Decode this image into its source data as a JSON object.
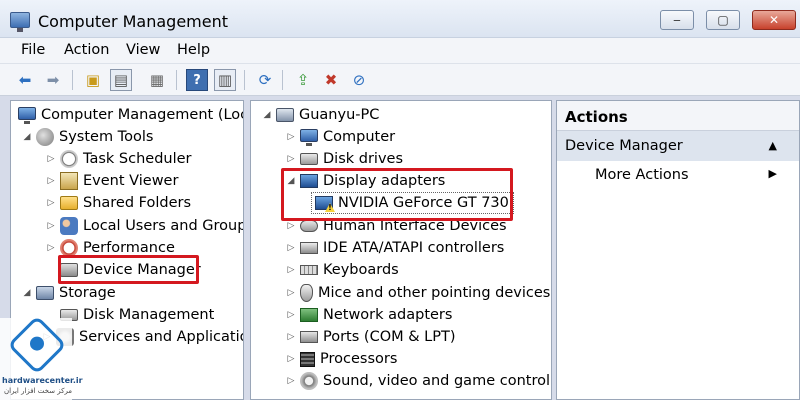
{
  "window": {
    "title": "Computer Management",
    "minimize_glyph": "‒",
    "maximize_glyph": "▢",
    "close_glyph": "✕"
  },
  "menu": {
    "items": [
      "File",
      "Action",
      "View",
      "Help"
    ]
  },
  "toolbar": {
    "icons": [
      "back-arrow-icon",
      "forward-arrow-icon",
      "up-folder-icon",
      "show-hide-tree-icon",
      "properties-icon",
      "help-icon",
      "show-hide-action-pane-icon",
      "scan-hardware-icon",
      "update-driver-icon",
      "uninstall-icon",
      "disable-device-icon"
    ]
  },
  "left_tree": {
    "root": "Computer Management (Local",
    "system_tools": "System Tools",
    "task_scheduler": "Task Scheduler",
    "event_viewer": "Event Viewer",
    "shared_folders": "Shared Folders",
    "local_users": "Local Users and Groups",
    "performance": "Performance",
    "device_manager": "Device Manager",
    "storage": "Storage",
    "disk_management": "Disk Management",
    "services": "Services and Applications"
  },
  "device_tree": {
    "root": "Guanyu-PC",
    "categories": {
      "computer": "Computer",
      "disk_drives": "Disk drives",
      "display_adapters": "Display adapters",
      "gpu": "NVIDIA GeForce GT 730",
      "hid": "Human Interface Devices",
      "ide": "IDE ATA/ATAPI controllers",
      "keyboards": "Keyboards",
      "mice": "Mice and other pointing devices",
      "network": "Network adapters",
      "ports": "Ports (COM & LPT)",
      "processors": "Processors",
      "sound": "Sound, video and game controlle"
    }
  },
  "actions": {
    "header": "Actions",
    "section": "Device Manager",
    "more_actions": "More Actions"
  },
  "watermark": {
    "site": "hardwarecenter.ir",
    "tagline": "مرکز سخت افزار ایران"
  },
  "colors": {
    "highlight_red": "#d4181f",
    "watermark_blue": "#1f77c8"
  }
}
